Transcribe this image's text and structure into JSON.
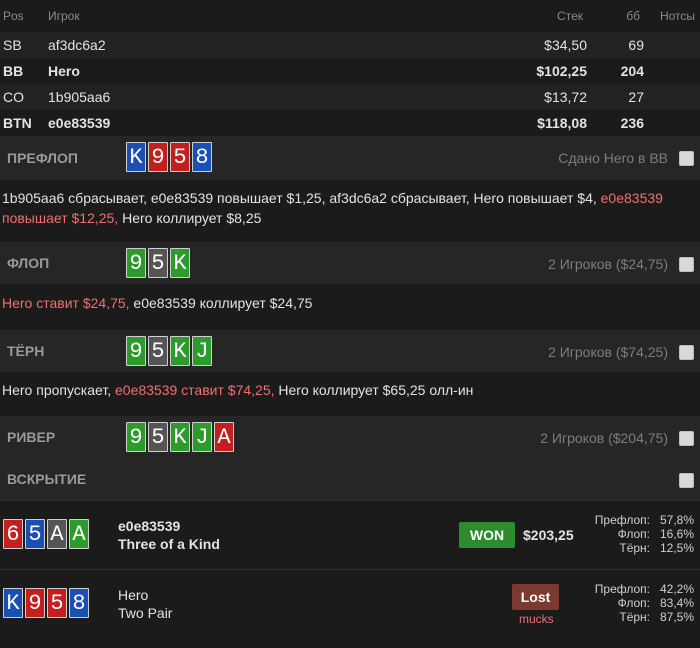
{
  "table": {
    "headers": {
      "pos": "Pos",
      "player": "Игрок",
      "stack": "Стек",
      "bb": "бб",
      "notes": "Нотсы"
    },
    "players": [
      {
        "pos": "SB",
        "name": "af3dc6a2",
        "stack": "$34,50",
        "bb": "69",
        "bold": false
      },
      {
        "pos": "BB",
        "name": "Hero",
        "stack": "$102,25",
        "bb": "204",
        "bold": true
      },
      {
        "pos": "CO",
        "name": "1b905aa6",
        "stack": "$13,72",
        "bb": "27",
        "bold": false
      },
      {
        "pos": "BTN",
        "name": "e0e83539",
        "stack": "$118,08",
        "bb": "236",
        "bold": true
      }
    ]
  },
  "preflop": {
    "title": "ПРЕФЛОП",
    "info": "Сдано Hero в BB",
    "cards": [
      {
        "rank": "K",
        "color": "blue"
      },
      {
        "rank": "9",
        "color": "red"
      },
      {
        "rank": "5",
        "color": "red"
      },
      {
        "rank": "8",
        "color": "blue"
      }
    ],
    "actions": {
      "part1": "1b905aa6 сбрасывает, e0e83539 повышает $1,25, af3dc6a2 сбрасывает, Hero повышает $4, ",
      "hl1": "e0e83539 повышает $12,25,",
      "part2": " Hero коллирует $8,25"
    }
  },
  "flop": {
    "title": "ФЛОП",
    "info": "2 Игроков ($24,75)",
    "cards": [
      {
        "rank": "9",
        "color": "green"
      },
      {
        "rank": "5",
        "color": "gray"
      },
      {
        "rank": "K",
        "color": "green"
      }
    ],
    "actions": {
      "hl1": "Hero ставит $24,75,",
      "part1": " e0e83539 коллирует $24,75"
    }
  },
  "turn": {
    "title": "ТЁРН",
    "info": "2 Игроков ($74,25)",
    "cards": [
      {
        "rank": "9",
        "color": "green"
      },
      {
        "rank": "5",
        "color": "gray"
      },
      {
        "rank": "K",
        "color": "green"
      },
      {
        "rank": "J",
        "color": "green"
      }
    ],
    "actions": {
      "part1": "Hero пропускает, ",
      "hl1": "e0e83539 ставит $74,25,",
      "part2": " Hero коллирует $65,25 олл-ин"
    }
  },
  "river": {
    "title": "РИВЕР",
    "info": "2 Игроков ($204,75)",
    "cards": [
      {
        "rank": "9",
        "color": "green"
      },
      {
        "rank": "5",
        "color": "gray"
      },
      {
        "rank": "K",
        "color": "green"
      },
      {
        "rank": "J",
        "color": "green"
      },
      {
        "rank": "A",
        "color": "red"
      }
    ]
  },
  "showdown": {
    "title": "ВСКРЫТИЕ",
    "players": [
      {
        "name": "e0e83539",
        "hand": "Three of a Kind",
        "cards": [
          {
            "rank": "6",
            "color": "red"
          },
          {
            "rank": "5",
            "color": "blue"
          },
          {
            "rank": "A",
            "color": "gray"
          },
          {
            "rank": "A",
            "color": "green"
          }
        ],
        "result": "WON",
        "amount": "$203,25",
        "equity": [
          {
            "label": "Префлоп:",
            "value": "57,8%"
          },
          {
            "label": "Флоп:",
            "value": "16,6%"
          },
          {
            "label": "Тёрн:",
            "value": "12,5%"
          }
        ]
      },
      {
        "name": "Hero",
        "hand": "Two Pair",
        "cards": [
          {
            "rank": "K",
            "color": "blue"
          },
          {
            "rank": "9",
            "color": "red"
          },
          {
            "rank": "5",
            "color": "red"
          },
          {
            "rank": "8",
            "color": "blue"
          }
        ],
        "result": "Lost",
        "note": "mucks",
        "equity": [
          {
            "label": "Префлоп:",
            "value": "42,2%"
          },
          {
            "label": "Флоп:",
            "value": "83,4%"
          },
          {
            "label": "Тёрн:",
            "value": "87,5%"
          }
        ]
      }
    ]
  },
  "colors": {
    "blue": "#1a50b4",
    "red": "#c31f1f",
    "green": "#2c9b2c",
    "gray": "#555555",
    "highlight": "#f07070",
    "won": "#2e8b2e",
    "lost": "#7a3a30"
  }
}
